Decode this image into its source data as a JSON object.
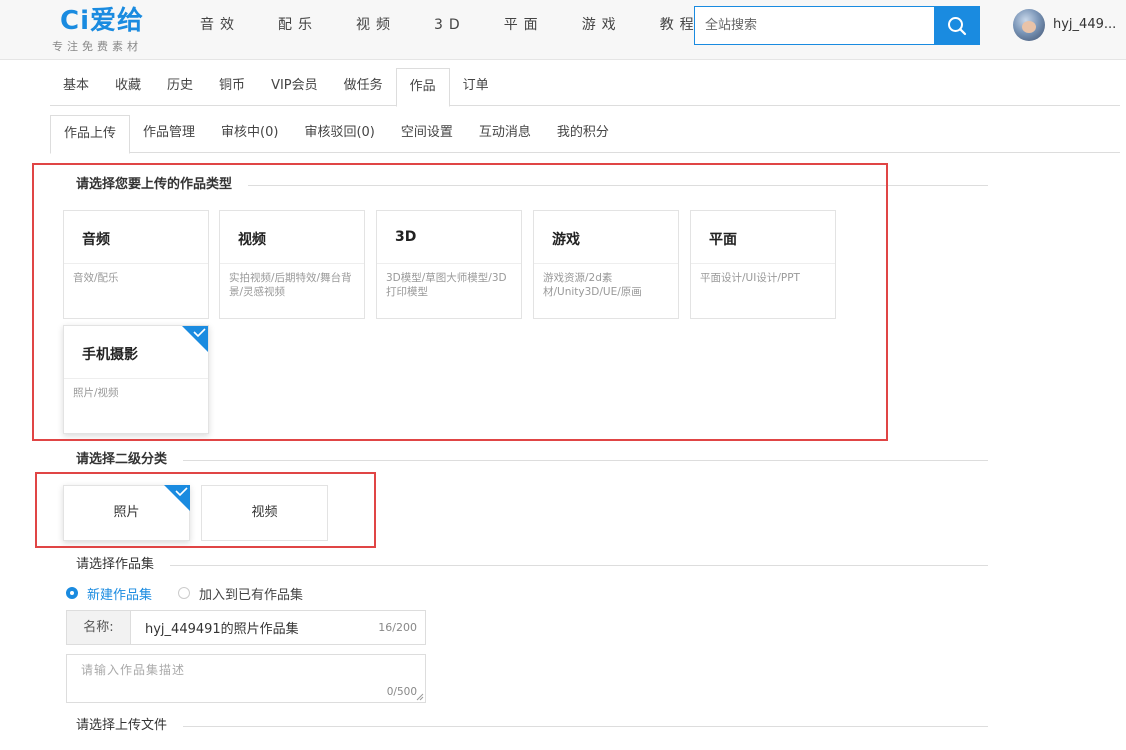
{
  "colors": {
    "accent": "#1a8be0",
    "highlight": "#e04545"
  },
  "header": {
    "logo_text": "Ci爱给",
    "logo_tagline": "专注免费素材",
    "nav": [
      "音效",
      "配乐",
      "视频",
      "3D",
      "平面",
      "游戏",
      "教程"
    ],
    "search": {
      "placeholder": "全站搜索",
      "icon": "search-icon"
    },
    "username": "hyj_449..."
  },
  "tabs1": {
    "items": [
      "基本",
      "收藏",
      "历史",
      "铜币",
      "VIP会员",
      "做任务",
      "作品",
      "订单"
    ],
    "active": "作品"
  },
  "tabs2": {
    "items": [
      "作品上传",
      "作品管理",
      "审核中(0)",
      "审核驳回(0)",
      "空间设置",
      "互动消息",
      "我的积分"
    ],
    "active": "作品上传"
  },
  "section1": {
    "title": "请选择您要上传的作品类型",
    "cards": [
      {
        "title": "音频",
        "desc": "音效/配乐",
        "selected": false
      },
      {
        "title": "视频",
        "desc": "实拍视频/后期特效/舞台背景/灵感视频",
        "selected": false
      },
      {
        "title": "3D",
        "desc": "3D模型/草图大师模型/3D打印模型",
        "selected": false
      },
      {
        "title": "游戏",
        "desc": "游戏资源/2d素材/Unity3D/UE/原画",
        "selected": false
      },
      {
        "title": "平面",
        "desc": "平面设计/UI设计/PPT",
        "selected": false
      },
      {
        "title": "手机摄影",
        "desc": "照片/视频",
        "selected": true
      }
    ]
  },
  "section2": {
    "title": "请选择二级分类",
    "options": [
      {
        "label": "照片",
        "selected": true
      },
      {
        "label": "视频",
        "selected": false
      }
    ]
  },
  "section3": {
    "title": "请选择作品集",
    "radios": [
      {
        "label": "新建作品集",
        "checked": true
      },
      {
        "label": "加入到已有作品集",
        "checked": false
      }
    ],
    "name_label": "名称:",
    "name_value": "hyj_449491的照片作品集",
    "name_count": "16/200",
    "desc_placeholder": "请输入作品集描述",
    "desc_count": "0/500"
  },
  "section4": {
    "title": "请选择上传文件"
  }
}
